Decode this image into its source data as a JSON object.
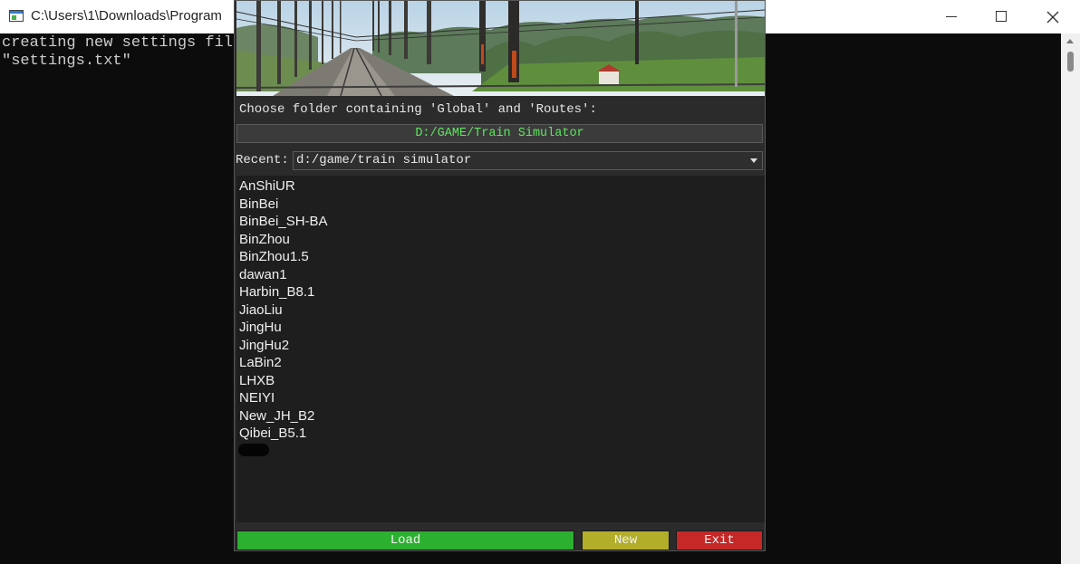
{
  "console": {
    "title": "C:\\Users\\1\\Downloads\\Program",
    "output_lines": [
      "creating new settings file",
      "\"settings.txt\""
    ]
  },
  "dialog": {
    "choose_label": "Choose folder containing 'Global' and 'Routes':",
    "folder_path": "D:/GAME/Train Simulator",
    "recent_label": "Recent:",
    "recent_value": "d:/game/train simulator",
    "routes": [
      "AnShiUR",
      "BinBei",
      "BinBei_SH-BA",
      "BinZhou",
      "BinZhou1.5",
      "dawan1",
      "Harbin_B8.1",
      "JiaoLiu",
      "JingHu",
      "JingHu2",
      "LaBin2",
      "LHXB",
      "NEIYI",
      "New_JH_B2",
      "Qibei_B5.1"
    ],
    "buttons": {
      "load": "Load",
      "new": "New",
      "exit": "Exit"
    }
  },
  "colors": {
    "load": "#2cb030",
    "new": "#b3ae2a",
    "exit": "#c62828",
    "folder_text": "#5ee65e"
  }
}
